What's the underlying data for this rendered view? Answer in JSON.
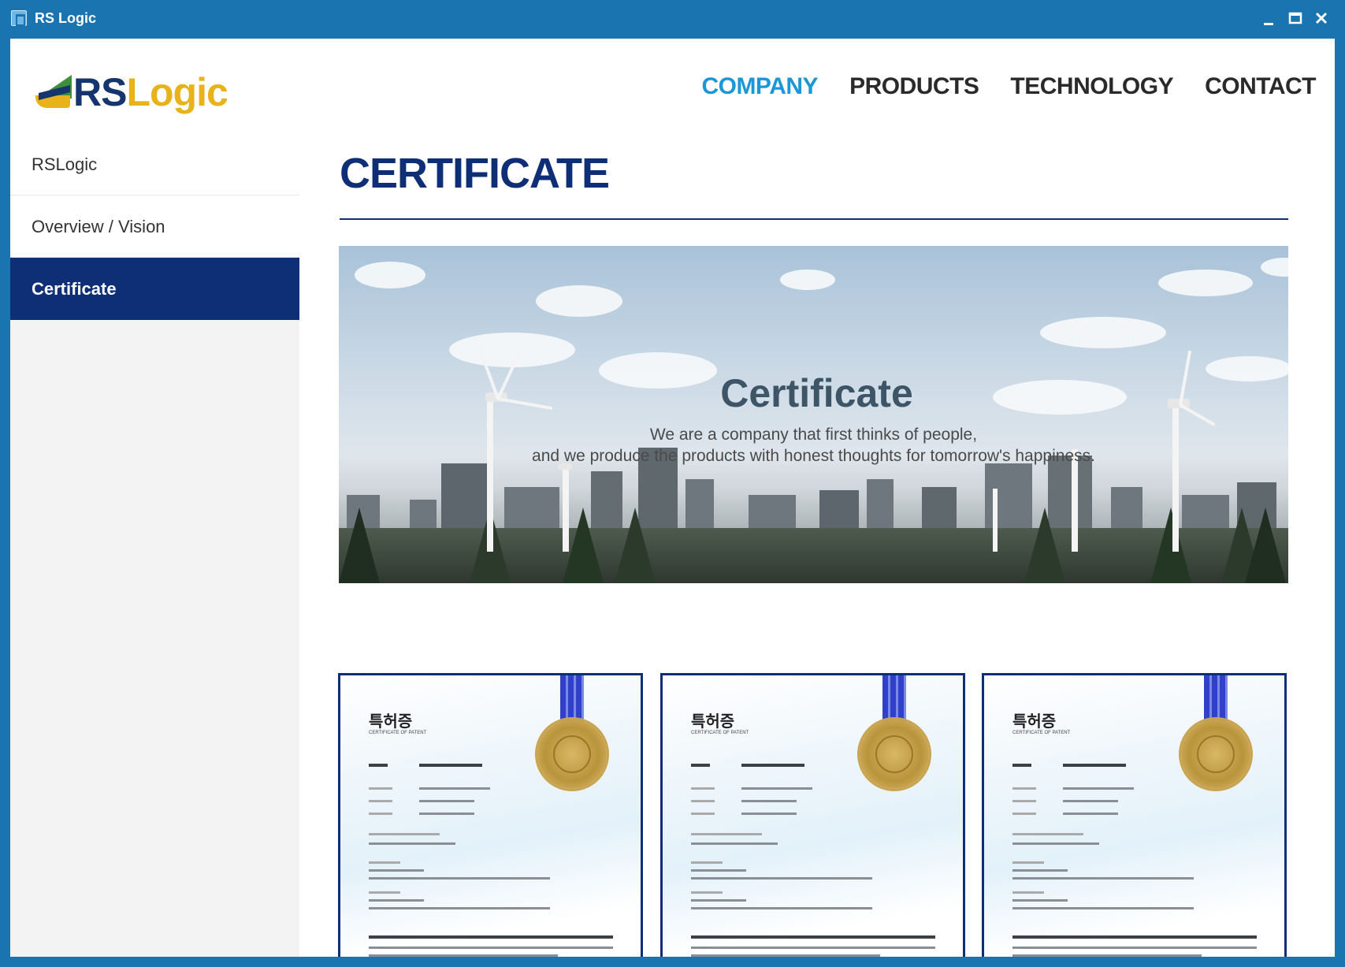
{
  "window": {
    "title": "RS Logic"
  },
  "logo": {
    "part1": "RS",
    "part2": "Logic"
  },
  "nav": [
    {
      "label": "COMPANY",
      "active": true
    },
    {
      "label": "PRODUCTS",
      "active": false
    },
    {
      "label": "TECHNOLOGY",
      "active": false
    },
    {
      "label": "CONTACT",
      "active": false
    }
  ],
  "sidebar": [
    {
      "label": "RSLogic",
      "active": false
    },
    {
      "label": "Overview / Vision",
      "active": false
    },
    {
      "label": "Certificate",
      "active": true
    }
  ],
  "page": {
    "title": "CERTIFICATE"
  },
  "banner": {
    "title": "Certificate",
    "subtitle_line1": "We are a company that first thinks of people,",
    "subtitle_line2": "and we produce the products with honest thoughts for tomorrow's happiness."
  },
  "certificates": [
    {
      "heading": "특허증",
      "subheading": "CERTIFICATE OF PATENT"
    },
    {
      "heading": "특허증",
      "subheading": "CERTIFICATE OF PATENT"
    },
    {
      "heading": "특허증",
      "subheading": "CERTIFICATE OF PATENT"
    }
  ],
  "colors": {
    "titlebar": "#1a74b0",
    "brand_navy": "#0e2f75",
    "nav_active": "#1c96d6",
    "logo_yellow": "#e8b21a"
  },
  "icons": {
    "app": "app-icon",
    "minimize": "minimize-icon",
    "maximize": "maximize-icon",
    "close": "close-icon"
  }
}
